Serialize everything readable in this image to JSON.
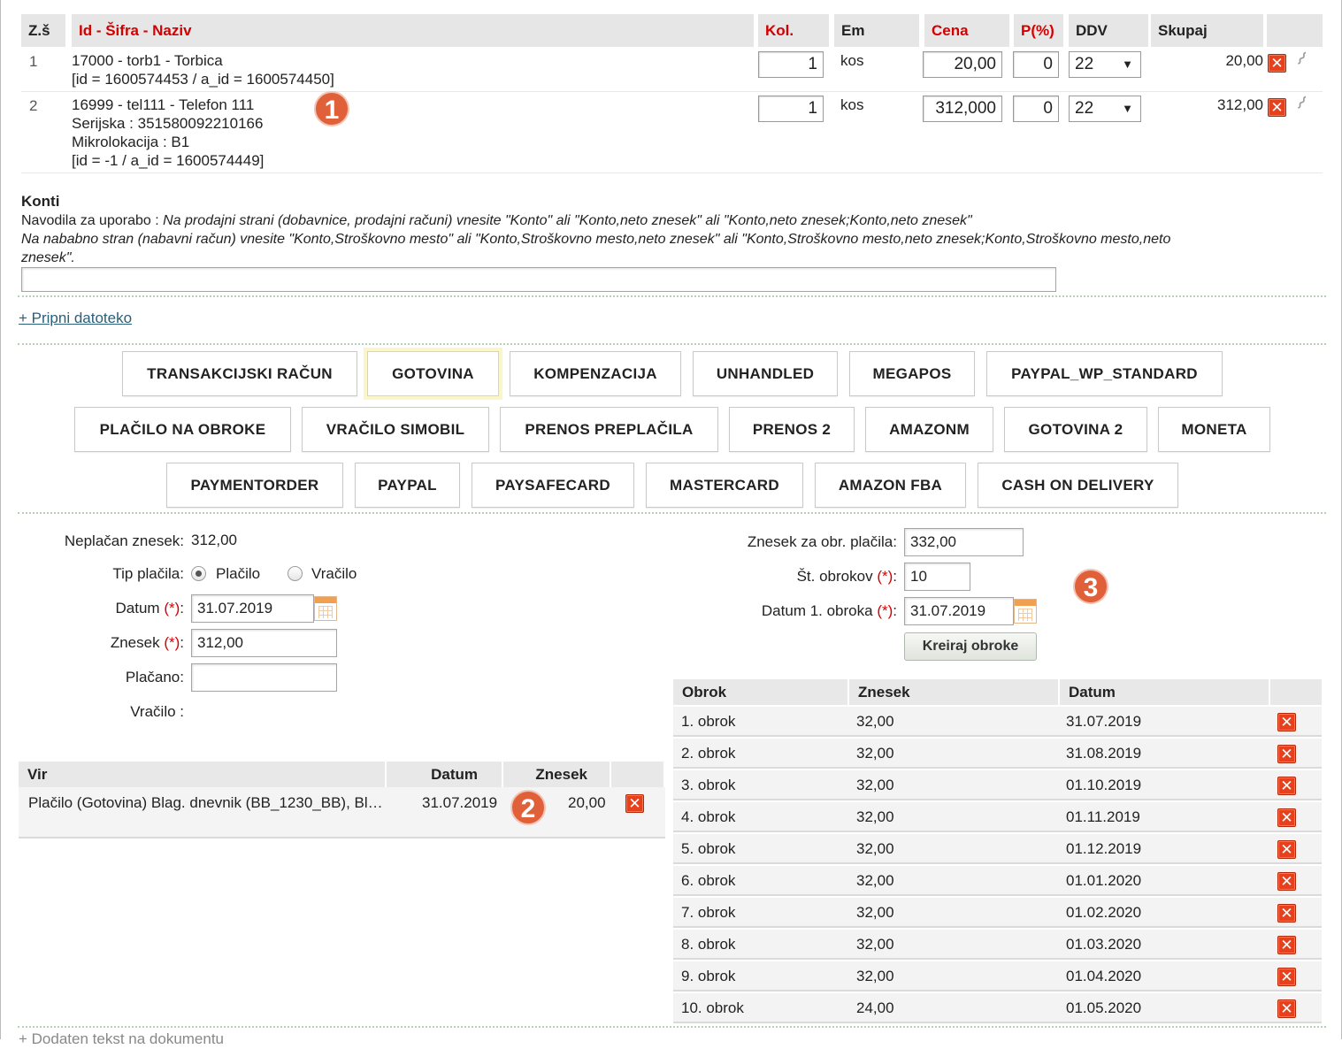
{
  "items_table": {
    "headers": {
      "zs": "Z.š",
      "naziv": "Id - Šifra - Naziv",
      "kol": "Kol.",
      "em": "Em",
      "cena": "Cena",
      "popust": "P(%)",
      "ddv": "DDV",
      "skupaj": "Skupaj"
    },
    "rows": [
      {
        "zs": "1",
        "line1": "17000 - torb1 - Torbica",
        "line2": "[id = 1600574453 / a_id = 1600574450]",
        "kol": "1",
        "em": "kos",
        "cena": "20,00",
        "popust": "0",
        "ddv": "22",
        "skupaj": "20,00"
      },
      {
        "zs": "2",
        "line1": "16999 - tel111 - Telefon 111",
        "line2": "Serijska : 351580092210166",
        "line3": "Mikrolokacija : B1",
        "line4": "[id = -1 / a_id = 1600574449]",
        "kol": "1",
        "em": "kos",
        "cena": "312,000",
        "popust": "0",
        "ddv": "22",
        "skupaj": "312,00"
      }
    ]
  },
  "badges": [
    "1",
    "2",
    "3"
  ],
  "konti": {
    "title": "Konti",
    "instr_prefix": "Navodila za uporabo : ",
    "instr1": "Na prodajni strani (dobavnice, prodajni računi) vnesite \"Konto\" ali \"Konto,neto znesek\" ali \"Konto,neto znesek;Konto,neto znesek\"",
    "instr2": "Na nababno stran (nabavni račun) vnesite \"Konto,Stroškovno mesto\" ali \"Konto,Stroškovno mesto,neto znesek\" ali \"Konto,Stroškovno mesto,neto znesek;Konto,Stroškovno mesto,neto",
    "instr3": "znesek\".",
    "value": ""
  },
  "attach_link": "+ Pripni datoteko",
  "payment_buttons": [
    "TRANSAKCIJSKI RAČUN",
    "GOTOVINA",
    "KOMPENZACIJA",
    "UNHANDLED",
    "MEGAPOS",
    "PAYPAL_WP_STANDARD",
    "PLAČILO NA OBROKE",
    "VRAČILO SIMOBIL",
    "PRENOS PREPLAČILA",
    "PRENOS 2",
    "AMAZONM",
    "GOTOVINA 2",
    "MONETA",
    "PAYMENTORDER",
    "PAYPAL",
    "PAYSAFECARD",
    "MASTERCARD",
    "AMAZON FBA",
    "CASH ON DELIVERY"
  ],
  "selected_payment": "GOTOVINA",
  "payment_form": {
    "neplacan_label": "Neplačan znesek:",
    "neplacan_value": "312,00",
    "tip_label": "Tip plačila:",
    "tip_placilo": "Plačilo",
    "tip_vracilo": "Vračilo",
    "tip_selected": "Plačilo",
    "datum_label": "Datum ",
    "required": "(*)",
    "colon": ":",
    "datum_value": "31.07.2019",
    "znesek_label": "Znesek ",
    "znesek_value": "312,00",
    "placano_label": "Plačano:",
    "placano_value": "",
    "vracilo_label": "Vračilo :"
  },
  "installments_form": {
    "znesek_label": "Znesek za obr. plačila:",
    "znesek_value": "332,00",
    "st_label": "Št. obrokov ",
    "st_value": "10",
    "datum_label": "Datum 1. obroka ",
    "datum_value": "31.07.2019",
    "create_button": "Kreiraj obroke"
  },
  "payments_list": {
    "headers": {
      "vir": "Vir",
      "datum": "Datum",
      "znesek": "Znesek"
    },
    "rows": [
      {
        "vir": "Plačilo (Gotovina) Blag. dnevnik (BB_1230_BB), Bl…",
        "datum": "31.07.2019",
        "znesek": "20,00"
      }
    ]
  },
  "installments_table": {
    "headers": {
      "obrok": "Obrok",
      "znesek": "Znesek",
      "datum": "Datum"
    },
    "rows": [
      {
        "obrok": "1. obrok",
        "znesek": "32,00",
        "datum": "31.07.2019"
      },
      {
        "obrok": "2. obrok",
        "znesek": "32,00",
        "datum": "31.08.2019"
      },
      {
        "obrok": "3. obrok",
        "znesek": "32,00",
        "datum": "01.10.2019"
      },
      {
        "obrok": "4. obrok",
        "znesek": "32,00",
        "datum": "01.11.2019"
      },
      {
        "obrok": "5. obrok",
        "znesek": "32,00",
        "datum": "01.12.2019"
      },
      {
        "obrok": "6. obrok",
        "znesek": "32,00",
        "datum": "01.01.2020"
      },
      {
        "obrok": "7. obrok",
        "znesek": "32,00",
        "datum": "01.02.2020"
      },
      {
        "obrok": "8. obrok",
        "znesek": "32,00",
        "datum": "01.03.2020"
      },
      {
        "obrok": "9. obrok",
        "znesek": "32,00",
        "datum": "01.04.2020"
      },
      {
        "obrok": "10. obrok",
        "znesek": "24,00",
        "datum": "01.05.2020"
      }
    ]
  },
  "bottom_link": "+ Dodaten tekst na dokumentu",
  "icons": {
    "delete": "delete-icon",
    "attach": "paperclip-icon",
    "calendar": "calendar-icon",
    "dropdown": "chevron-down-icon"
  },
  "colors": {
    "required_red": "#d40000",
    "delete_orange": "#e8401c",
    "badge": "#e0603a",
    "selected_glow": "#fbf6c8"
  }
}
